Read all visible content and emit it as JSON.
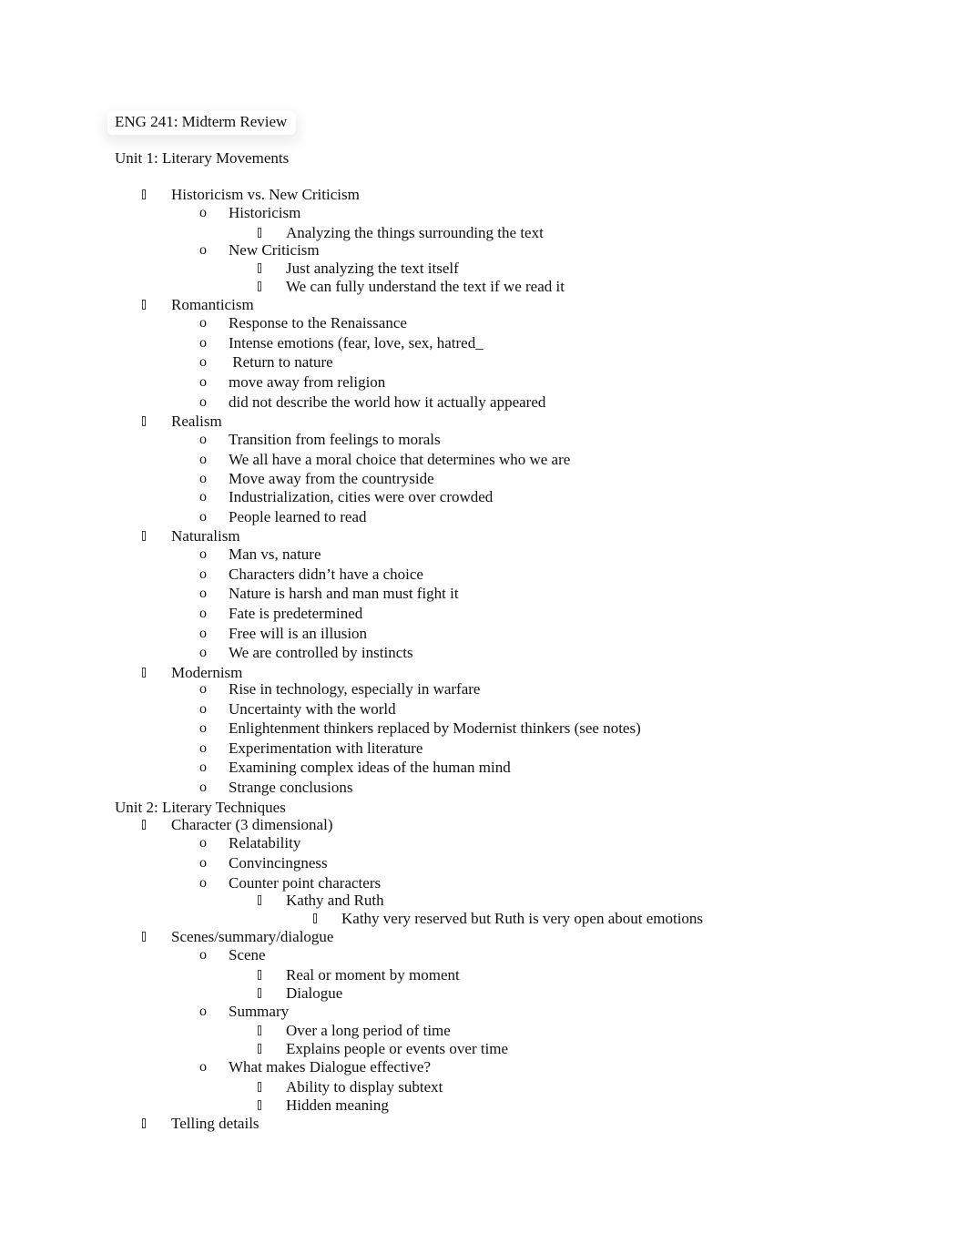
{
  "document": {
    "title": "ENG 241: Midterm Review",
    "units": [
      {
        "heading": "Unit 1: Literary Movements",
        "lines": [
          {
            "level": 1,
            "bullet": "box-bullet-icon",
            "text": "Historicism vs. New Criticism"
          },
          {
            "level": 2,
            "bullet": "o",
            "text": "Historicism"
          },
          {
            "level": 3,
            "bullet": "box-bullet-icon",
            "text": "Analyzing the things surrounding the text"
          },
          {
            "level": 2,
            "bullet": "o",
            "text": "New Criticism"
          },
          {
            "level": 3,
            "bullet": "box-bullet-icon",
            "text": "Just analyzing the text itself"
          },
          {
            "level": 3,
            "bullet": "box-bullet-icon",
            "text": "We can fully understand the text if we read it"
          },
          {
            "level": 1,
            "bullet": "box-bullet-icon",
            "text": "Romanticism"
          },
          {
            "level": 2,
            "bullet": "o",
            "text": "Response to the Renaissance"
          },
          {
            "level": 2,
            "bullet": "o",
            "text": "Intense emotions (fear, love, sex, hatred_"
          },
          {
            "level": 2,
            "bullet": "o",
            "text": " Return to nature"
          },
          {
            "level": 2,
            "bullet": "o",
            "text": "move away from religion"
          },
          {
            "level": 2,
            "bullet": "o",
            "text": "did not describe the world how it actually appeared"
          },
          {
            "level": 1,
            "bullet": "box-bullet-icon",
            "text": "Realism"
          },
          {
            "level": 2,
            "bullet": "o",
            "text": "Transition from feelings to morals"
          },
          {
            "level": 2,
            "bullet": "o",
            "text": "We all have a moral choice that determines who we are"
          },
          {
            "level": 2,
            "bullet": "o",
            "text": "Move away from the countryside"
          },
          {
            "level": 2,
            "bullet": "o",
            "text": "Industrialization, cities were over crowded"
          },
          {
            "level": 2,
            "bullet": "o",
            "text": "People learned to read"
          },
          {
            "level": 1,
            "bullet": "box-bullet-icon",
            "text": "Naturalism"
          },
          {
            "level": 2,
            "bullet": "o",
            "text": "Man vs, nature"
          },
          {
            "level": 2,
            "bullet": "o",
            "text": "Characters didn’t have a choice"
          },
          {
            "level": 2,
            "bullet": "o",
            "text": "Nature is harsh and man must fight it"
          },
          {
            "level": 2,
            "bullet": "o",
            "text": "Fate is predetermined"
          },
          {
            "level": 2,
            "bullet": "o",
            "text": "Free will is an illusion"
          },
          {
            "level": 2,
            "bullet": "o",
            "text": "We are controlled by instincts"
          },
          {
            "level": 1,
            "bullet": "box-bullet-icon",
            "text": "Modernism"
          },
          {
            "level": 2,
            "bullet": "o",
            "text": "Rise in technology, especially in warfare"
          },
          {
            "level": 2,
            "bullet": "o",
            "text": "Uncertainty with the world"
          },
          {
            "level": 2,
            "bullet": "o",
            "text": "Enlightenment thinkers replaced by Modernist thinkers (see notes)"
          },
          {
            "level": 2,
            "bullet": "o",
            "text": "Experimentation with literature"
          },
          {
            "level": 2,
            "bullet": "o",
            "text": "Examining complex ideas of the human mind"
          },
          {
            "level": 2,
            "bullet": "o",
            "text": "Strange conclusions"
          }
        ]
      },
      {
        "heading": "Unit 2: Literary Techniques",
        "lines": [
          {
            "level": 1,
            "bullet": "box-bullet-icon",
            "text": "Character (3 dimensional)"
          },
          {
            "level": 2,
            "bullet": "o",
            "text": "Relatability"
          },
          {
            "level": 2,
            "bullet": "o",
            "text": "Convincingness"
          },
          {
            "level": 2,
            "bullet": "o",
            "text": "Counter point characters"
          },
          {
            "level": 3,
            "bullet": "box-bullet-icon",
            "text": "Kathy and Ruth"
          },
          {
            "level": 4,
            "bullet": "box-bullet-icon",
            "text": "Kathy very reserved but Ruth is very open about emotions"
          },
          {
            "level": 1,
            "bullet": "box-bullet-icon",
            "text": "Scenes/summary/dialogue"
          },
          {
            "level": 2,
            "bullet": "o",
            "text": "Scene"
          },
          {
            "level": 3,
            "bullet": "box-bullet-icon",
            "text": "Real or moment by moment"
          },
          {
            "level": 3,
            "bullet": "box-bullet-icon",
            "text": "Dialogue"
          },
          {
            "level": 2,
            "bullet": "o",
            "text": "Summary"
          },
          {
            "level": 3,
            "bullet": "box-bullet-icon",
            "text": "Over a long period of time"
          },
          {
            "level": 3,
            "bullet": "box-bullet-icon",
            "text": "Explains people or events over time"
          },
          {
            "level": 2,
            "bullet": "o",
            "text": "What makes Dialogue effective?"
          },
          {
            "level": 3,
            "bullet": "box-bullet-icon",
            "text": "Ability to display subtext"
          },
          {
            "level": 3,
            "bullet": "box-bullet-icon",
            "text": "Hidden meaning"
          },
          {
            "level": 1,
            "bullet": "box-bullet-icon",
            "text": "Telling details"
          }
        ]
      }
    ]
  }
}
